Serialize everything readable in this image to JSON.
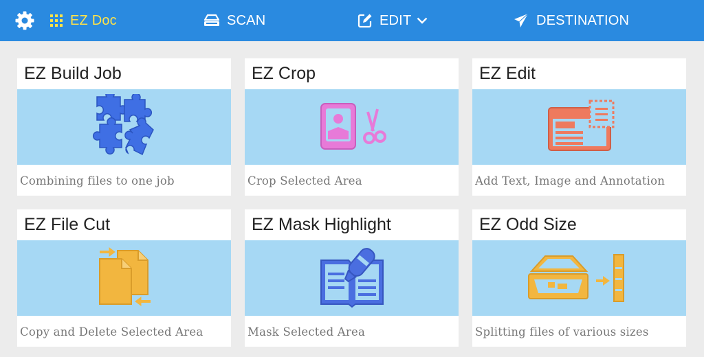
{
  "header": {
    "app_title": "EZ Doc",
    "nav": {
      "scan": "SCAN",
      "edit": "EDIT",
      "destination": "DESTINATION"
    }
  },
  "cards": [
    {
      "title": "EZ Build Job",
      "description": "Combining files to one job",
      "icon": "puzzle-icon"
    },
    {
      "title": "EZ Crop",
      "description": "Crop Selected Area",
      "icon": "crop-scissors-icon"
    },
    {
      "title": "EZ Edit",
      "description": "Add Text, Image and Annotation",
      "icon": "edit-document-icon"
    },
    {
      "title": "EZ File Cut",
      "description": "Copy and Delete Selected Area",
      "icon": "file-cut-icon"
    },
    {
      "title": "EZ Mask Highlight",
      "description": "Mask Selected Area",
      "icon": "mask-highlight-icon"
    },
    {
      "title": "EZ Odd Size",
      "description": "Splitting files of various sizes",
      "icon": "scanner-split-icon"
    }
  ],
  "colors": {
    "header_bg": "#2a8ae0",
    "active_accent": "#ffe24a",
    "banner_bg": "#a6d8f4",
    "page_bg": "#ececec"
  }
}
